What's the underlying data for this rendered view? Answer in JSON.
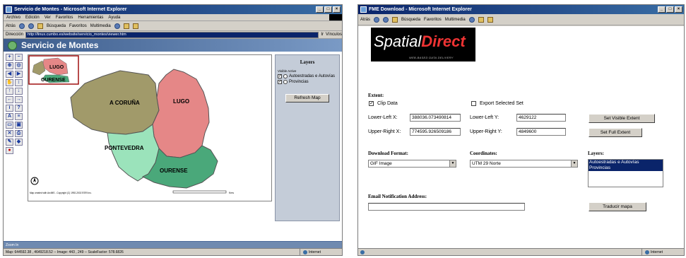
{
  "left_window": {
    "title": "Servicio de Montes - Microsoft Internet Explorer",
    "menu": [
      "Archivo",
      "Edición",
      "Ver",
      "Favoritos",
      "Herramientas",
      "Ayuda"
    ],
    "toolbar": {
      "back": "Atrás",
      "search": "Búsqueda",
      "favorites": "Favoritos",
      "media": "Multimedia"
    },
    "address_label": "Dirección",
    "address": "http://linux.cumbo.es/website/servicio_montes/viewer.htm",
    "go": "Ir",
    "links": "Vínculos",
    "page_header": "Servicio de Montes",
    "overview_labels": [
      "LUGO",
      "OURENSE"
    ],
    "map_regions": [
      "A CORUÑA",
      "LUGO",
      "PONTEVEDRA",
      "OURENSE"
    ],
    "map_credit": "Map created with ArcIMS - Copyright (C) 1992-2002 ESRI Inc.",
    "scale_label": "Kms",
    "layers_title": "Layers",
    "layers_sub": "Visible Active",
    "layers": [
      {
        "label": "Autoestradas e Autovías",
        "visible": true,
        "active": false
      },
      {
        "label": "Provincias",
        "visible": true,
        "active": false
      }
    ],
    "refresh_label": "Refresh Map",
    "footer_label": "Zoom In",
    "status": "Map: 644592.38 , 4649218.52 -- Image: 443 , 249 -- ScaleFactor: 578.6826",
    "status_zone": "Internet"
  },
  "right_window": {
    "title": "FME Download - Microsoft Internet Explorer",
    "toolbar": {
      "back": "Atrás",
      "search": "Búsqueda",
      "favorites": "Favoritos",
      "media": "Multimedia"
    },
    "logo_main": "Spatial",
    "logo_accent": "Direct",
    "logo_tag": "WEB-BASED DATA DELIVERY",
    "extent_label": "Extent:",
    "clip_label": "Clip Data",
    "clip_checked": true,
    "export_label": "Export Selected Set",
    "export_checked": false,
    "lower_left_x_label": "Lower-Left X:",
    "lower_left_x": "388036.073490814",
    "lower_left_y_label": "Lower-Left Y:",
    "lower_left_y": "4629122",
    "upper_right_x_label": "Upper-Right X:",
    "upper_right_x": "774595.926509186",
    "upper_right_y_label": "Upper-Right Y:",
    "upper_right_y": "4849600",
    "set_visible_label": "Set Visible Extent",
    "set_full_label": "Set Full Extent",
    "download_format_label": "Download Format:",
    "download_format": "GIF Image",
    "coordinates_label": "Coordinates:",
    "coordinates": "UTM 29 Norte",
    "layers_label": "Layers:",
    "layers": [
      "Autoestradas e Autovías",
      "Provincias"
    ],
    "email_label": "Email Notification Address:",
    "email_value": "",
    "translate_label": "Traducir mapa",
    "status_zone": "Internet"
  }
}
